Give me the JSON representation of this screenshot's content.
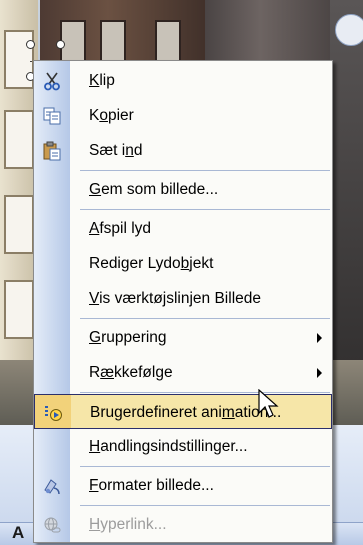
{
  "menu": {
    "items": [
      {
        "id": "cut",
        "pre": "",
        "key": "K",
        "post": "lip",
        "icon": "scissors-icon",
        "enabled": true,
        "submenu": false
      },
      {
        "id": "copy",
        "pre": "K",
        "key": "o",
        "post": "pier",
        "icon": "copy-icon",
        "enabled": true,
        "submenu": false
      },
      {
        "id": "paste",
        "pre": "Sæt i",
        "key": "n",
        "post": "d",
        "icon": "paste-icon",
        "enabled": true,
        "submenu": false
      },
      {
        "id": "save-as-picture",
        "pre": "",
        "key": "G",
        "post": "em som billede...",
        "icon": "",
        "enabled": true,
        "submenu": false
      },
      {
        "id": "play-sound",
        "pre": "",
        "key": "A",
        "post": "fspil lyd",
        "icon": "",
        "enabled": true,
        "submenu": false
      },
      {
        "id": "edit-sound-object",
        "pre": "Rediger Lydo",
        "key": "b",
        "post": "jekt",
        "icon": "",
        "enabled": true,
        "submenu": false
      },
      {
        "id": "show-picture-toolbar",
        "pre": "",
        "key": "V",
        "post": "is værktøjslinjen Billede",
        "icon": "",
        "enabled": true,
        "submenu": false
      },
      {
        "id": "grouping",
        "pre": "",
        "key": "G",
        "post": "ruppering",
        "icon": "",
        "enabled": true,
        "submenu": true
      },
      {
        "id": "order",
        "pre": "R",
        "key": "æ",
        "post": "kkefølge",
        "icon": "",
        "enabled": true,
        "submenu": true
      },
      {
        "id": "custom-animation",
        "pre": "Brugerdefineret ani",
        "key": "m",
        "post": "ation...",
        "icon": "animation-icon",
        "enabled": true,
        "submenu": false,
        "highlighted": true
      },
      {
        "id": "action-settings",
        "pre": "",
        "key": "H",
        "post": "andlingsindstillinger...",
        "icon": "",
        "enabled": true,
        "submenu": false
      },
      {
        "id": "format-picture",
        "pre": "",
        "key": "F",
        "post": "ormater billede...",
        "icon": "format-picture-icon",
        "enabled": true,
        "submenu": false
      },
      {
        "id": "hyperlink",
        "pre": "",
        "key": "H",
        "post": "yperlink...",
        "icon": "hyperlink-icon",
        "enabled": false,
        "submenu": false
      }
    ]
  },
  "toolbar": {
    "font_color_glyph": "A"
  },
  "colors": {
    "highlight_bg": "#f6e6a8",
    "highlight_border": "#2b2f6b",
    "icon_column": "#b5c8e7",
    "separator": "#a9b8d4"
  }
}
